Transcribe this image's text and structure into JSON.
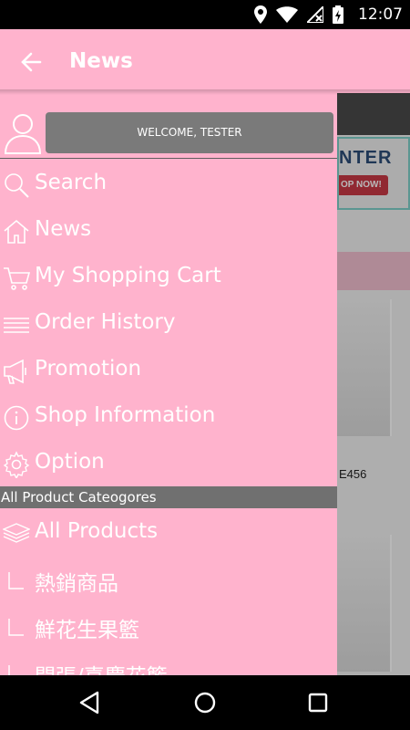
{
  "status_bar": {
    "time": "12:07",
    "icons": [
      "location-icon",
      "wifi-icon",
      "no-signal-icon",
      "battery-charging-icon"
    ]
  },
  "app_bar": {
    "back_icon": "arrow-left-icon",
    "title": "News"
  },
  "background": {
    "banner_title": "NTER",
    "banner_button": "OP NOW!",
    "product_caption": "E456"
  },
  "drawer": {
    "user": {
      "avatar_icon": "user-icon",
      "welcome": "WELCOME, TESTER"
    },
    "menu": [
      {
        "icon": "search-icon",
        "label": "Search"
      },
      {
        "icon": "home-icon",
        "label": "News"
      },
      {
        "icon": "cart-icon",
        "label": "My Shopping Cart"
      },
      {
        "icon": "list-icon",
        "label": "Order History"
      },
      {
        "icon": "megaphone-icon",
        "label": "Promotion"
      },
      {
        "icon": "info-icon",
        "label": "Shop Information"
      },
      {
        "icon": "gear-icon",
        "label": "Option"
      }
    ],
    "categories_header": "All Product Cateogores",
    "categories": [
      {
        "icon": "stack-icon",
        "label": "All Products"
      },
      {
        "icon": "subitem-icon",
        "label": "熱銷商品"
      },
      {
        "icon": "subitem-icon",
        "label": "鮮花生果籃"
      },
      {
        "icon": "subitem-icon",
        "label": "開張/喜慶花籃"
      }
    ]
  },
  "nav_bar": {
    "buttons": [
      "back-triangle-icon",
      "home-circle-icon",
      "recents-square-icon"
    ]
  },
  "colors": {
    "primary_pink": "#ffb3cd",
    "section_gray": "#707070",
    "button_gray": "#7a7a7a"
  }
}
